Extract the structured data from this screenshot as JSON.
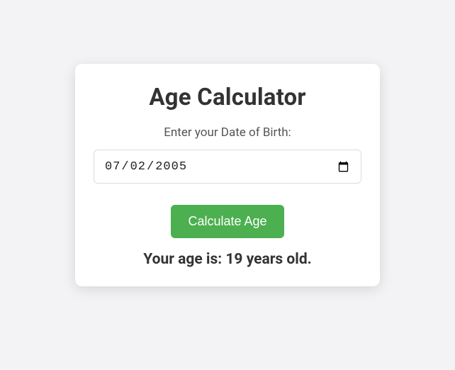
{
  "title": "Age Calculator",
  "label": "Enter your Date of Birth:",
  "date_value": "2005-07-02",
  "button_label": "Calculate Age",
  "result_text": "Your age is: 19 years old."
}
